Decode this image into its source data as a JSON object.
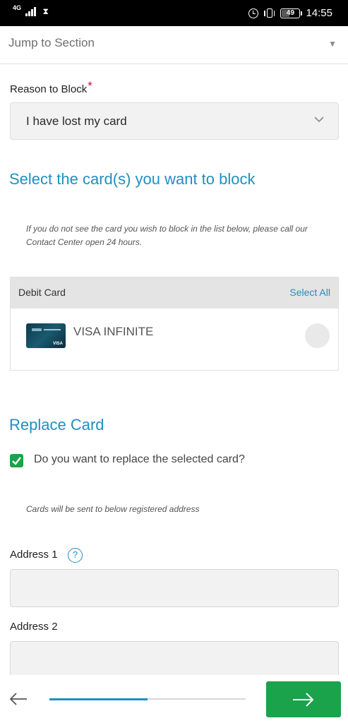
{
  "status_bar": {
    "network": "4G",
    "time": "14:55",
    "battery_percent": "49",
    "battery_level": 0.49,
    "icons": [
      "signal-icon",
      "hourglass-icon",
      "alarm-icon",
      "vibrate-icon",
      "battery-icon"
    ]
  },
  "jump": {
    "label": "Jump to Section",
    "caret": "▼"
  },
  "reason": {
    "label": "Reason to Block",
    "required_mark": "*",
    "selected": "I have lost my card"
  },
  "select_cards": {
    "title": "Select the card(s) you want to block",
    "note_line1": "If you do not see the card you wish to block in the list below, please call our",
    "note_line2": "Contact Center open 24 hours.",
    "list_header": "Debit Card",
    "select_all": "Select All",
    "cards": [
      {
        "name": "VISA INFINITE",
        "brand": "VISA"
      }
    ]
  },
  "replace": {
    "title": "Replace Card",
    "question": "Do you want to replace the selected card?",
    "checked": true,
    "note": "Cards will be sent to below registered address"
  },
  "address": {
    "address1_label": "Address 1",
    "address1_value": "",
    "help_symbol": "?",
    "address2_label": "Address 2",
    "address2_value": ""
  },
  "footer": {
    "progress": 0.5
  },
  "colors": {
    "accent": "#1f8fc2",
    "success": "#1aa34a",
    "required": "#c8102e"
  }
}
